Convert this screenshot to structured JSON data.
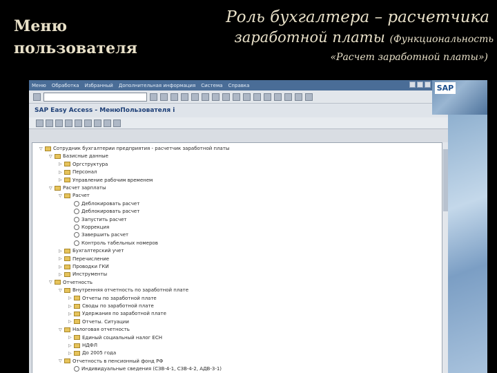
{
  "slide": {
    "left_title_line1": "Меню",
    "left_title_line2": "пользователя",
    "right_title_line1": "Роль  бухгалтера – расчетчика",
    "right_title_line2": "заработной платы",
    "right_title_line2_small": "(Функциональность",
    "right_title_line3": "«Расчет заработной платы»)"
  },
  "sap": {
    "menu_items": [
      "Меню",
      "Обработка",
      "Избранный",
      "Дополнительная информация",
      "Система",
      "Справка"
    ],
    "logo": "SAP",
    "screen_title": "SAP Easy Access  -  МенюПользователя i"
  },
  "tree": [
    {
      "level": 0,
      "type": "folder",
      "open": true,
      "label": "Сотрудник бухгалтерии предприятия - расчетчик заработной платы"
    },
    {
      "level": 1,
      "type": "folder",
      "open": true,
      "label": "Базисные данные"
    },
    {
      "level": 2,
      "type": "folder",
      "open": false,
      "label": "Оргструктура"
    },
    {
      "level": 2,
      "type": "folder",
      "open": false,
      "label": "Персонал"
    },
    {
      "level": 2,
      "type": "folder",
      "open": false,
      "label": "Управление рабочим временем"
    },
    {
      "level": 1,
      "type": "folder",
      "open": true,
      "label": "Расчет зарплаты"
    },
    {
      "level": 2,
      "type": "folder",
      "open": true,
      "label": "Расчет"
    },
    {
      "level": 3,
      "type": "txn",
      "label": "Деблокировать расчет"
    },
    {
      "level": 3,
      "type": "txn",
      "label": "Деблокировать расчет"
    },
    {
      "level": 3,
      "type": "txn",
      "label": "Запустить расчет"
    },
    {
      "level": 3,
      "type": "txn",
      "label": "Коррекция"
    },
    {
      "level": 3,
      "type": "txn",
      "label": "Завершить расчет"
    },
    {
      "level": 3,
      "type": "txn",
      "label": "Контроль табельных номеров"
    },
    {
      "level": 2,
      "type": "folder",
      "open": false,
      "label": "Бухгалтерский учет"
    },
    {
      "level": 2,
      "type": "folder",
      "open": false,
      "label": "Перечисление"
    },
    {
      "level": 2,
      "type": "folder",
      "open": false,
      "label": "Проводки ГКИ"
    },
    {
      "level": 2,
      "type": "folder",
      "open": false,
      "label": "Инструменты"
    },
    {
      "level": 1,
      "type": "folder",
      "open": true,
      "label": "Отчетность"
    },
    {
      "level": 2,
      "type": "folder",
      "open": true,
      "label": "Внутренняя отчетность по заработной плате"
    },
    {
      "level": 3,
      "type": "folder",
      "open": false,
      "label": "Отчеты по заработной плате"
    },
    {
      "level": 3,
      "type": "folder",
      "open": false,
      "label": "Своды по заработной плате"
    },
    {
      "level": 3,
      "type": "folder",
      "open": false,
      "label": "Удержания по заработной плате"
    },
    {
      "level": 3,
      "type": "folder",
      "open": false,
      "label": "Отчеты. Ситуации"
    },
    {
      "level": 2,
      "type": "folder",
      "open": true,
      "label": "Налоговая отчетность"
    },
    {
      "level": 3,
      "type": "folder",
      "open": false,
      "label": "Единый социальный налог ЕСН"
    },
    {
      "level": 3,
      "type": "folder",
      "open": false,
      "label": "НДФЛ"
    },
    {
      "level": 3,
      "type": "folder",
      "open": false,
      "label": "До 2005 года"
    },
    {
      "level": 2,
      "type": "folder",
      "open": true,
      "label": "Отчетность в пенсионный фонд РФ"
    },
    {
      "level": 3,
      "type": "txn",
      "label": "Индивидуальные сведения (СЗВ-4-1, СЗВ-4-2, АДВ-3-1)"
    }
  ]
}
